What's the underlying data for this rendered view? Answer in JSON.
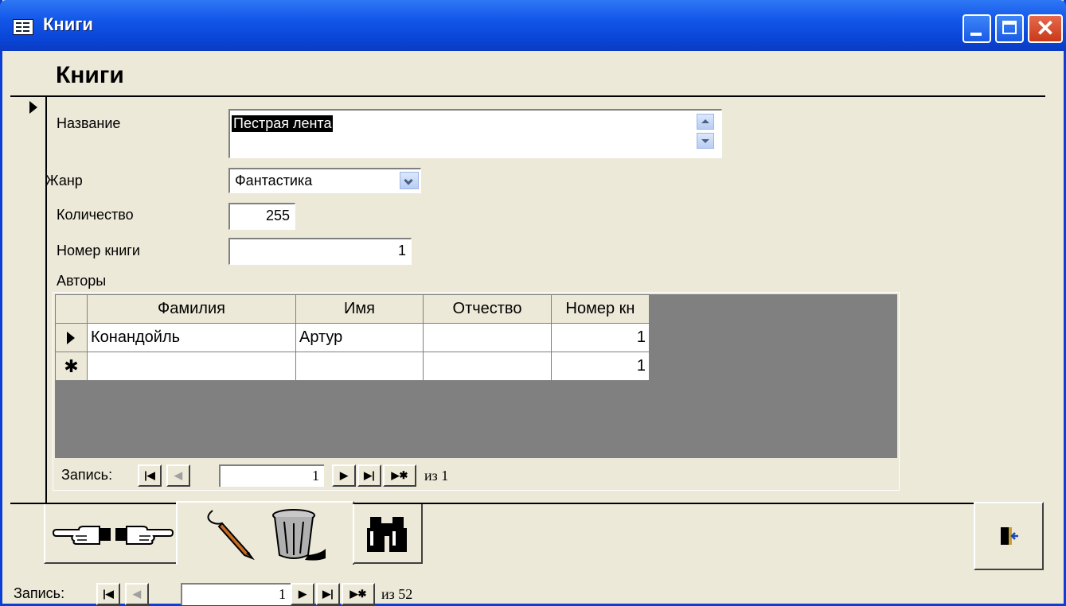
{
  "window": {
    "title": "Книги"
  },
  "form": {
    "header": "Книги",
    "fields": {
      "name": {
        "label": "Название",
        "value": "Пестрая лента"
      },
      "genre": {
        "label": "Жанр",
        "value": "Фантастика"
      },
      "quantity": {
        "label": "Количество",
        "value": "255"
      },
      "book_number": {
        "label": "Номер книги",
        "value": "1"
      }
    },
    "authors_label": "Авторы"
  },
  "subform": {
    "columns": [
      "Фамилия",
      "Имя",
      "Отчество",
      "Номер кн"
    ],
    "rows": [
      {
        "surname": "Конандойль",
        "name": "Артур",
        "patronymic": "",
        "book_no": "1"
      }
    ],
    "new_row": {
      "book_no": "1"
    },
    "nav": {
      "label": "Запись:",
      "current": "1",
      "of_text": "из 1"
    }
  },
  "main_nav": {
    "label": "Запись:",
    "current": "1",
    "of_text": "из 52"
  },
  "nav_buttons": {
    "first": "|◀",
    "prev": "◀",
    "next": "▶",
    "last": "▶|",
    "new": "▶✱"
  },
  "toolbar_icons": [
    "pointing-hand-left-icon",
    "pointing-hand-right-icon",
    "pen-icon",
    "trash-can-icon",
    "binoculars-icon",
    "exit-door-icon"
  ],
  "colors": {
    "titlebar": "#0A46D8",
    "window_bg": "#ECE9D8",
    "grid_bg": "#808080",
    "close_button": "#C9391A"
  }
}
